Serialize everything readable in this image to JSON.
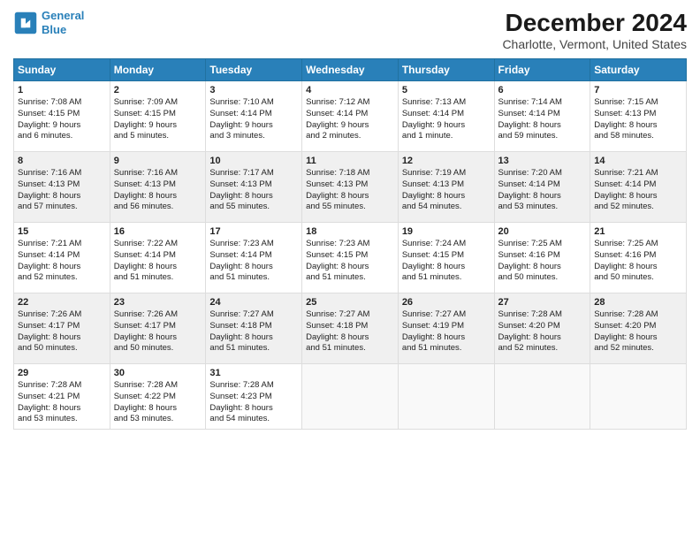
{
  "header": {
    "logo_line1": "General",
    "logo_line2": "Blue",
    "title": "December 2024",
    "subtitle": "Charlotte, Vermont, United States"
  },
  "days_of_week": [
    "Sunday",
    "Monday",
    "Tuesday",
    "Wednesday",
    "Thursday",
    "Friday",
    "Saturday"
  ],
  "weeks": [
    [
      {
        "day": "1",
        "info": "Sunrise: 7:08 AM\nSunset: 4:15 PM\nDaylight: 9 hours\nand 6 minutes."
      },
      {
        "day": "2",
        "info": "Sunrise: 7:09 AM\nSunset: 4:15 PM\nDaylight: 9 hours\nand 5 minutes."
      },
      {
        "day": "3",
        "info": "Sunrise: 7:10 AM\nSunset: 4:14 PM\nDaylight: 9 hours\nand 3 minutes."
      },
      {
        "day": "4",
        "info": "Sunrise: 7:12 AM\nSunset: 4:14 PM\nDaylight: 9 hours\nand 2 minutes."
      },
      {
        "day": "5",
        "info": "Sunrise: 7:13 AM\nSunset: 4:14 PM\nDaylight: 9 hours\nand 1 minute."
      },
      {
        "day": "6",
        "info": "Sunrise: 7:14 AM\nSunset: 4:14 PM\nDaylight: 8 hours\nand 59 minutes."
      },
      {
        "day": "7",
        "info": "Sunrise: 7:15 AM\nSunset: 4:13 PM\nDaylight: 8 hours\nand 58 minutes."
      }
    ],
    [
      {
        "day": "8",
        "info": "Sunrise: 7:16 AM\nSunset: 4:13 PM\nDaylight: 8 hours\nand 57 minutes."
      },
      {
        "day": "9",
        "info": "Sunrise: 7:16 AM\nSunset: 4:13 PM\nDaylight: 8 hours\nand 56 minutes."
      },
      {
        "day": "10",
        "info": "Sunrise: 7:17 AM\nSunset: 4:13 PM\nDaylight: 8 hours\nand 55 minutes."
      },
      {
        "day": "11",
        "info": "Sunrise: 7:18 AM\nSunset: 4:13 PM\nDaylight: 8 hours\nand 55 minutes."
      },
      {
        "day": "12",
        "info": "Sunrise: 7:19 AM\nSunset: 4:13 PM\nDaylight: 8 hours\nand 54 minutes."
      },
      {
        "day": "13",
        "info": "Sunrise: 7:20 AM\nSunset: 4:14 PM\nDaylight: 8 hours\nand 53 minutes."
      },
      {
        "day": "14",
        "info": "Sunrise: 7:21 AM\nSunset: 4:14 PM\nDaylight: 8 hours\nand 52 minutes."
      }
    ],
    [
      {
        "day": "15",
        "info": "Sunrise: 7:21 AM\nSunset: 4:14 PM\nDaylight: 8 hours\nand 52 minutes."
      },
      {
        "day": "16",
        "info": "Sunrise: 7:22 AM\nSunset: 4:14 PM\nDaylight: 8 hours\nand 51 minutes."
      },
      {
        "day": "17",
        "info": "Sunrise: 7:23 AM\nSunset: 4:14 PM\nDaylight: 8 hours\nand 51 minutes."
      },
      {
        "day": "18",
        "info": "Sunrise: 7:23 AM\nSunset: 4:15 PM\nDaylight: 8 hours\nand 51 minutes."
      },
      {
        "day": "19",
        "info": "Sunrise: 7:24 AM\nSunset: 4:15 PM\nDaylight: 8 hours\nand 51 minutes."
      },
      {
        "day": "20",
        "info": "Sunrise: 7:25 AM\nSunset: 4:16 PM\nDaylight: 8 hours\nand 50 minutes."
      },
      {
        "day": "21",
        "info": "Sunrise: 7:25 AM\nSunset: 4:16 PM\nDaylight: 8 hours\nand 50 minutes."
      }
    ],
    [
      {
        "day": "22",
        "info": "Sunrise: 7:26 AM\nSunset: 4:17 PM\nDaylight: 8 hours\nand 50 minutes."
      },
      {
        "day": "23",
        "info": "Sunrise: 7:26 AM\nSunset: 4:17 PM\nDaylight: 8 hours\nand 50 minutes."
      },
      {
        "day": "24",
        "info": "Sunrise: 7:27 AM\nSunset: 4:18 PM\nDaylight: 8 hours\nand 51 minutes."
      },
      {
        "day": "25",
        "info": "Sunrise: 7:27 AM\nSunset: 4:18 PM\nDaylight: 8 hours\nand 51 minutes."
      },
      {
        "day": "26",
        "info": "Sunrise: 7:27 AM\nSunset: 4:19 PM\nDaylight: 8 hours\nand 51 minutes."
      },
      {
        "day": "27",
        "info": "Sunrise: 7:28 AM\nSunset: 4:20 PM\nDaylight: 8 hours\nand 52 minutes."
      },
      {
        "day": "28",
        "info": "Sunrise: 7:28 AM\nSunset: 4:20 PM\nDaylight: 8 hours\nand 52 minutes."
      }
    ],
    [
      {
        "day": "29",
        "info": "Sunrise: 7:28 AM\nSunset: 4:21 PM\nDaylight: 8 hours\nand 53 minutes."
      },
      {
        "day": "30",
        "info": "Sunrise: 7:28 AM\nSunset: 4:22 PM\nDaylight: 8 hours\nand 53 minutes."
      },
      {
        "day": "31",
        "info": "Sunrise: 7:28 AM\nSunset: 4:23 PM\nDaylight: 8 hours\nand 54 minutes."
      },
      {
        "day": "",
        "info": ""
      },
      {
        "day": "",
        "info": ""
      },
      {
        "day": "",
        "info": ""
      },
      {
        "day": "",
        "info": ""
      }
    ]
  ]
}
